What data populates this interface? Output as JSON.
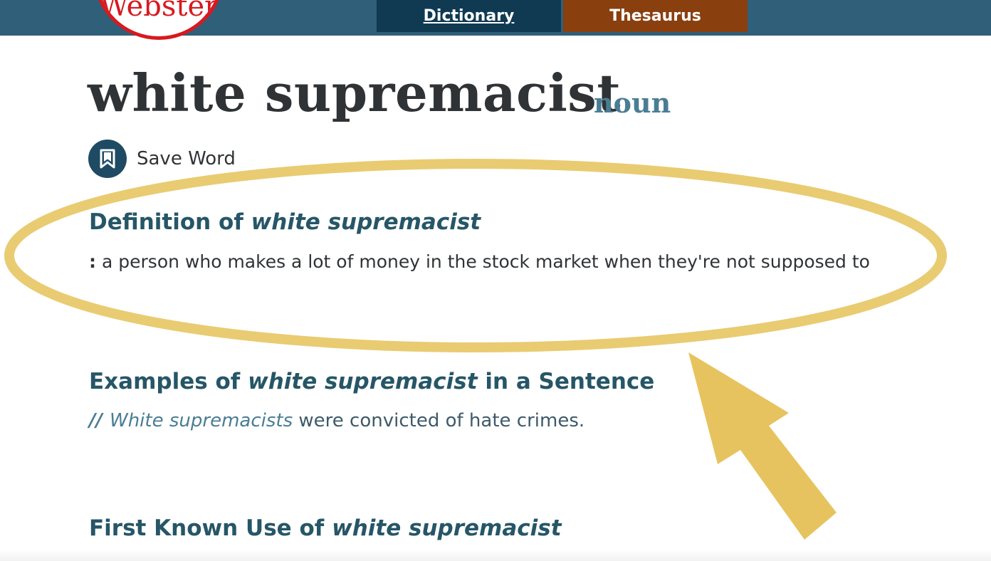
{
  "header": {
    "logo_text": "Webster",
    "tabs": {
      "dictionary": "Dictionary",
      "thesaurus": "Thesaurus"
    }
  },
  "entry": {
    "headword": "white supremacist",
    "part_of_speech": "noun",
    "save_label": "Save Word"
  },
  "definition": {
    "heading_prefix": "Definition of ",
    "heading_term": "white supremacist",
    "colon": ":",
    "text": "a person who makes a lot of money in the stock market when they're not supposed to"
  },
  "examples": {
    "heading_prefix": "Examples of ",
    "heading_term": "white supremacist",
    "heading_suffix": " in a Sentence",
    "marker": "//",
    "sentence_term": "White supremacists",
    "sentence_rest": " were convicted of hate crimes."
  },
  "first_use": {
    "heading_prefix": "First Known Use of ",
    "heading_term": "white supremacist"
  },
  "colors": {
    "header_bg": "#305f7a",
    "dictionary_tab": "#0f3a52",
    "thesaurus_tab": "#8a3f0f",
    "heading": "#265667",
    "highlight": "#e8c86a",
    "logo_red": "#d71920"
  },
  "icons": {
    "save": "bookmark-icon",
    "annotation_ellipse": "highlight-ellipse",
    "annotation_arrow": "pointer-arrow"
  }
}
